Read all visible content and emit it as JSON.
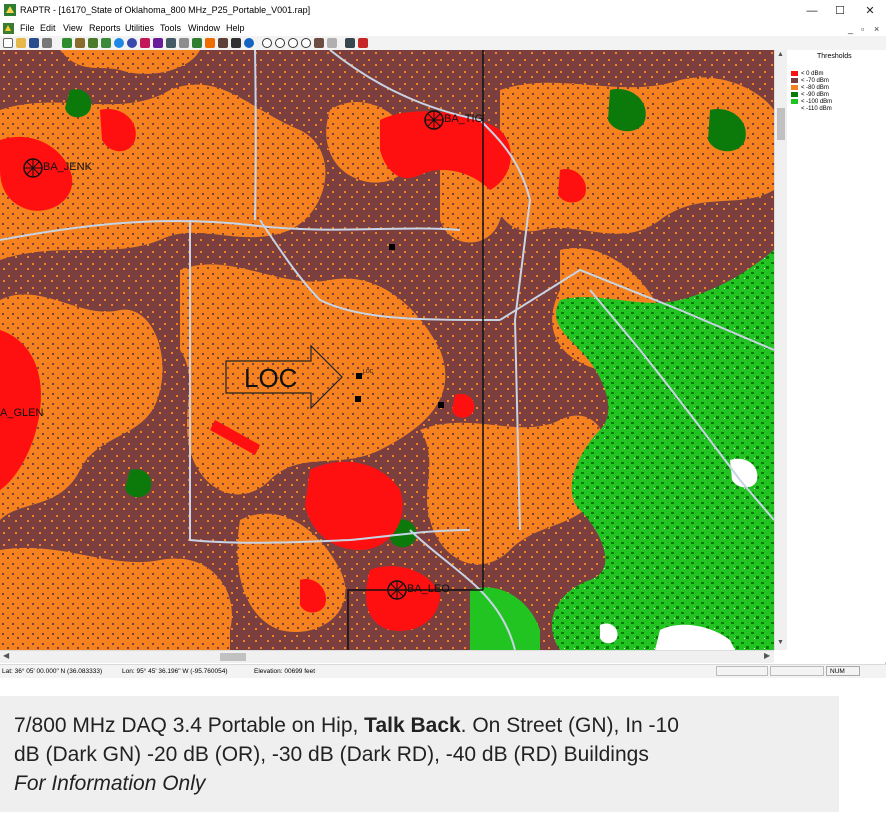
{
  "window": {
    "title": "RAPTR - [16170_State of Oklahoma_800 MHz_P25_Portable_V001.rap]",
    "controls": {
      "minimize": "—",
      "maximize": "☐",
      "close": "✕"
    },
    "mdi_controls": {
      "minimize": "_",
      "restore": "▫",
      "close": "×"
    }
  },
  "menu": {
    "items": [
      "File",
      "Edit",
      "View",
      "Reports",
      "Utilities",
      "Tools",
      "Window",
      "Help"
    ]
  },
  "map": {
    "sites": [
      {
        "name": "BA_TIG"
      },
      {
        "name": "BA_JENK"
      },
      {
        "name": "A_GLEN"
      },
      {
        "name": "BA_LEO"
      }
    ],
    "loc_label": "LOC",
    "loc_marker_label": "LOC",
    "colors": {
      "base_dark_red": "#7b3f3f",
      "orange": "#f5821e",
      "red": "#ff1010",
      "dark_green": "#0b7a0b",
      "green": "#22c422",
      "light_green": "#7de07d",
      "road": "#c8d4e4",
      "boundary": "#111111"
    }
  },
  "legend": {
    "title": "Thresholds",
    "rows": [
      {
        "label": "< 0 dBm",
        "color": "#ff1010"
      },
      {
        "label": "< -70 dBm",
        "color": "#7b3f3f"
      },
      {
        "label": "< -80 dBm",
        "color": "#f5821e"
      },
      {
        "label": "< -90 dBm",
        "color": "#0b7a0b"
      },
      {
        "label": "< -100 dBm",
        "color": "#22c422"
      },
      {
        "label": "< -110 dBm",
        "color": "#ffffff"
      }
    ]
  },
  "status": {
    "lat": "Lat: 36° 05' 00.000\" N (36.083333)",
    "lon": "Lon: 95° 45' 36.196\" W (-95.760054)",
    "elevation": "Elevation: 00699 feet",
    "num": "NUM"
  },
  "caption": {
    "line1_prefix": "7/800 MHz DAQ 3.4 Portable on Hip, ",
    "line1_bold": "Talk Back",
    "line1_suffix": ".  On Street (GN),  In -10",
    "line2": "dB (Dark GN) -20 dB (OR), -30 dB (Dark RD), -40 dB (RD) Buildings",
    "line3": "For Information Only"
  }
}
